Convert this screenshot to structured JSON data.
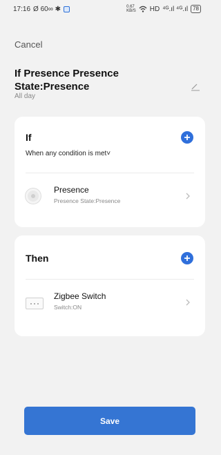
{
  "status_bar": {
    "time": "17:16",
    "left_icons": "Ø 60∞ ✱",
    "net_speed": "0.67",
    "net_unit": "KB/S",
    "hd": "HD",
    "signal": "⁴ᴳ.ıl ⁴ᴳ.ıl",
    "battery": "78"
  },
  "header": {
    "cancel_label": "Cancel",
    "title": "If Presence Presence State:Presence",
    "subtitle": "All day"
  },
  "if_section": {
    "title": "If",
    "condition_mode": "When any condition is met˅",
    "items": [
      {
        "name": "Presence",
        "description": "Presence State:Presence",
        "icon": "presence-sensor-icon"
      }
    ]
  },
  "then_section": {
    "title": "Then",
    "items": [
      {
        "name": "Zigbee Switch",
        "description": "Switch:ON",
        "icon": "switch-device-icon"
      }
    ]
  },
  "save_label": "Save",
  "colors": {
    "accent": "#3575d3",
    "background": "#f2f2f2",
    "card": "#ffffff"
  }
}
